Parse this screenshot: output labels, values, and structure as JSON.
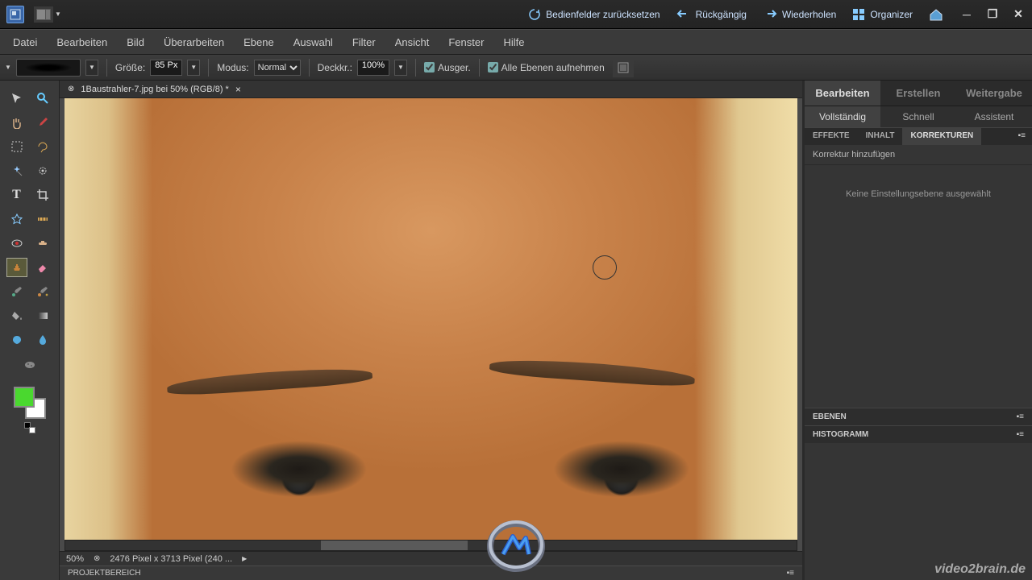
{
  "titlebar": {
    "reset_panels": "Bedienfelder zurücksetzen",
    "undo": "Rückgängig",
    "redo": "Wiederholen",
    "organizer": "Organizer"
  },
  "menu": {
    "items": [
      "Datei",
      "Bearbeiten",
      "Bild",
      "Überarbeiten",
      "Ebene",
      "Auswahl",
      "Filter",
      "Ansicht",
      "Fenster",
      "Hilfe"
    ]
  },
  "options": {
    "size_label": "Größe:",
    "size_value": "85 Px",
    "mode_label": "Modus:",
    "mode_value": "Normal",
    "opacity_label": "Deckkr.:",
    "opacity_value": "100%",
    "ausger_label": "Ausger.",
    "alle_ebenen_label": "Alle Ebenen aufnehmen"
  },
  "document": {
    "tab_title": "1Baustrahler-7.jpg bei 50% (RGB/8) *",
    "zoom": "50%",
    "dimensions": "2476 Pixel x 3713 Pixel (240 ..."
  },
  "project_bar": "PROJEKTBEREICH",
  "right": {
    "top_tabs": {
      "edit": "Bearbeiten",
      "create": "Erstellen",
      "share": "Weitergabe"
    },
    "sub_tabs": {
      "full": "Vollständig",
      "quick": "Schnell",
      "assist": "Assistent"
    },
    "panel_tabs": {
      "effects": "EFFEKTE",
      "content": "INHALT",
      "corrections": "KORREKTUREN"
    },
    "add_correction": "Korrektur hinzufügen",
    "no_layer": "Keine Einstellungsebene ausgewählt",
    "layers": "EBENEN",
    "histogram": "HISTOGRAMM"
  },
  "colors": {
    "fg": "#4ad82f",
    "bg": "#ffffff"
  },
  "watermark": "video2brain.de"
}
